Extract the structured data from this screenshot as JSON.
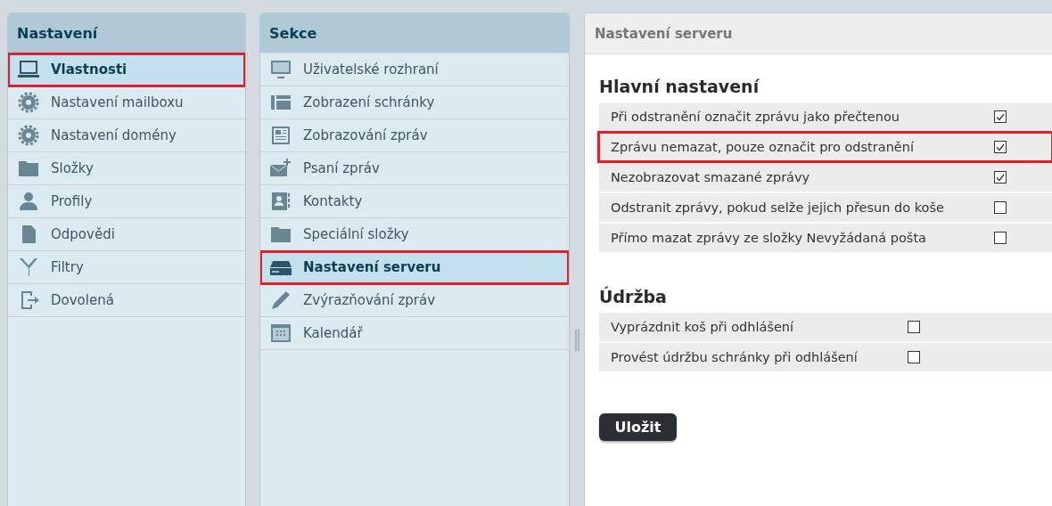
{
  "settings_panel": {
    "title": "Nastavení",
    "items": [
      {
        "label": "Vlastnosti",
        "selected": true,
        "highlighted": true
      },
      {
        "label": "Nastavení mailboxu",
        "selected": false,
        "highlighted": false
      },
      {
        "label": "Nastavení domény",
        "selected": false,
        "highlighted": false
      },
      {
        "label": "Složky",
        "selected": false,
        "highlighted": false
      },
      {
        "label": "Profily",
        "selected": false,
        "highlighted": false
      },
      {
        "label": "Odpovědi",
        "selected": false,
        "highlighted": false
      },
      {
        "label": "Filtry",
        "selected": false,
        "highlighted": false
      },
      {
        "label": "Dovolená",
        "selected": false,
        "highlighted": false
      }
    ]
  },
  "sections_panel": {
    "title": "Sekce",
    "items": [
      {
        "label": "Uživatelské rozhraní",
        "selected": false,
        "highlighted": false
      },
      {
        "label": "Zobrazení schránky",
        "selected": false,
        "highlighted": false
      },
      {
        "label": "Zobrazování zpráv",
        "selected": false,
        "highlighted": false
      },
      {
        "label": "Psaní zpráv",
        "selected": false,
        "highlighted": false
      },
      {
        "label": "Kontakty",
        "selected": false,
        "highlighted": false
      },
      {
        "label": "Speciální složky",
        "selected": false,
        "highlighted": false
      },
      {
        "label": "Nastavení serveru",
        "selected": true,
        "highlighted": true
      },
      {
        "label": "Zvýrazňování zpráv",
        "selected": false,
        "highlighted": false
      },
      {
        "label": "Kalendář",
        "selected": false,
        "highlighted": false
      }
    ]
  },
  "content": {
    "title": "Nastavení serveru",
    "groups": [
      {
        "heading": "Hlavní nastavení",
        "options": [
          {
            "label": "Při odstranění označit zprávu jako přečtenou",
            "checked": true,
            "highlighted": false
          },
          {
            "label": "Zprávu nemazat, pouze označit pro odstranění",
            "checked": true,
            "highlighted": true
          },
          {
            "label": "Nezobrazovat smazané zprávy",
            "checked": true,
            "highlighted": false
          },
          {
            "label": "Odstranit zprávy, pokud selže jejich přesun do koše",
            "checked": false,
            "highlighted": false
          },
          {
            "label": "Přímo mazat zprávy ze složky Nevyžádaná pošta",
            "checked": false,
            "highlighted": false
          }
        ]
      },
      {
        "heading": "Údržba",
        "options": [
          {
            "label": "Vyprázdnit koš při odhlášení",
            "checked": false,
            "highlighted": false
          },
          {
            "label": "Provést údržbu schránky při odhlášení",
            "checked": false,
            "highlighted": false
          }
        ]
      }
    ],
    "save_button": "Uložit"
  }
}
